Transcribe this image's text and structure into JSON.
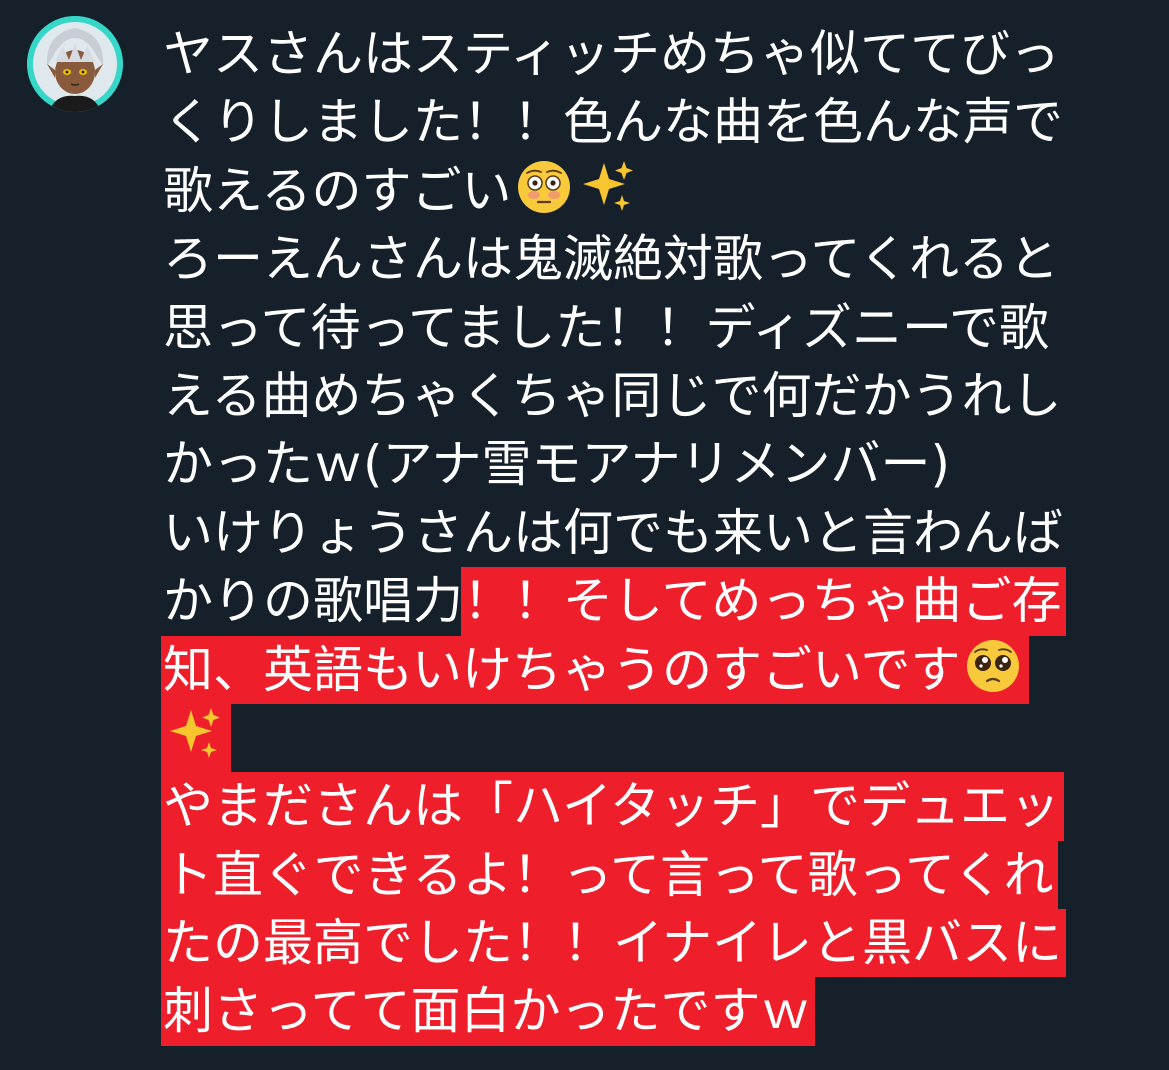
{
  "post": {
    "avatar_alt": "avatar",
    "lines": [
      {
        "plain": "ヤスさんはスティッチめちゃ似ててびっ"
      },
      {
        "plain": "くりしました！！色んな曲を色んな声で"
      },
      {
        "plain": "歌えるのすごい",
        "emoji": [
          "flushed-face",
          "sparkles"
        ]
      },
      {
        "plain": "ろーえんさんは鬼滅絶対歌ってくれると"
      },
      {
        "plain": "思って待ってました！！ディズニーで歌"
      },
      {
        "plain": "える曲めちゃくちゃ同じで何だかうれし"
      },
      {
        "plain": "かったｗ(アナ雪モアナリメンバー)"
      },
      {
        "plain": "いけりょうさんは何でも来いと言わんば"
      },
      {
        "plain": "かりの歌唱力",
        "highlight": "！！そしてめっちゃ曲ご存"
      },
      {
        "highlight": "知、英語もいけちゃうのすごいです",
        "emoji": [
          "pleading-face"
        ]
      },
      {
        "emoji": [
          "sparkles"
        ]
      },
      {
        "highlight": "やまださんは「ハイタッチ」でデュエッ"
      },
      {
        "highlight": "ト直ぐできるよ！って言って歌ってくれ"
      },
      {
        "highlight": "たの最高でした！！イナイレと黒バスに"
      },
      {
        "highlight": "刺さってて面白かったですｗ"
      }
    ]
  },
  "colors": {
    "background": "#16202a",
    "text": "#ffffff",
    "highlight": "#ee1e2b",
    "avatar_ring": "#36d6c8"
  }
}
